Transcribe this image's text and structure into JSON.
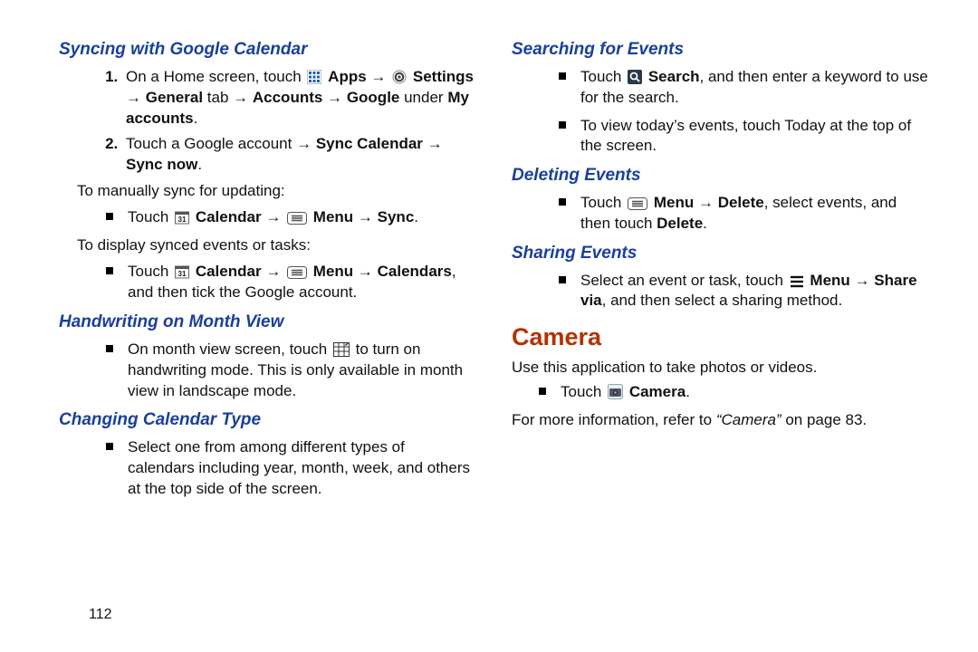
{
  "arrow": "→",
  "left": {
    "sync": {
      "heading": "Syncing with Google Calendar",
      "step1_pre": "On a Home screen, touch ",
      "step1_apps": "Apps",
      "step1_settings": "Settings",
      "step1_line2a": "General",
      "step1_line2b": " tab ",
      "step1_line2c": "Accounts",
      "step1_line2d": "Google",
      "step1_line2e": " under ",
      "step1_line2f": "My accounts",
      "step2_pre": "Touch a Google account ",
      "step2_b1": "Sync Calendar",
      "step2_b2": "Sync now",
      "manual": "To manually sync for updating:",
      "manual_b_pre": "Touch ",
      "manual_b_cal": "Calendar",
      "manual_b_menu": "Menu",
      "manual_b_sync": "Sync",
      "display": "To display synced events or tasks:",
      "disp_b_pre": "Touch ",
      "disp_b_cal": "Calendar",
      "disp_b_menu": "Menu",
      "disp_b_cals": "Calendars",
      "disp_b_tail": ", and then tick the Google account."
    },
    "hand": {
      "heading": "Handwriting on Month View",
      "b1_pre": "On month view screen, touch ",
      "b1_post": " to turn on handwriting mode. This is only available in month view in landscape mode."
    },
    "chg": {
      "heading": "Changing Calendar Type",
      "b1": "Select one from among different types of calendars including year, month, week, and others at the top side of the screen."
    }
  },
  "right": {
    "search": {
      "heading": "Searching for Events",
      "b1_pre": "Touch ",
      "b1_s": "Search",
      "b1_post": ", and then enter a keyword to use for the search.",
      "b2": "To view today’s events, touch Today at the top of the screen."
    },
    "del": {
      "heading": "Deleting Events",
      "b1_pre": "Touch ",
      "b1_menu": "Menu",
      "b1_del": "Delete",
      "b1_mid": ", select events, and then touch ",
      "b1_del2": "Delete"
    },
    "share": {
      "heading": "Sharing Events",
      "b1_pre": "Select an event or task, touch ",
      "b1_menu": "Menu",
      "b1_sv": "Share via",
      "b1_post": ", and then select a sharing method."
    },
    "camera": {
      "heading": "Camera",
      "intro": "Use this application to take photos or videos.",
      "b1_pre": "Touch ",
      "b1_cam": "Camera",
      "more_pre": "For more information, refer to ",
      "more_it": "“Camera”",
      "more_post": " on page 83."
    }
  },
  "page_number": "112"
}
